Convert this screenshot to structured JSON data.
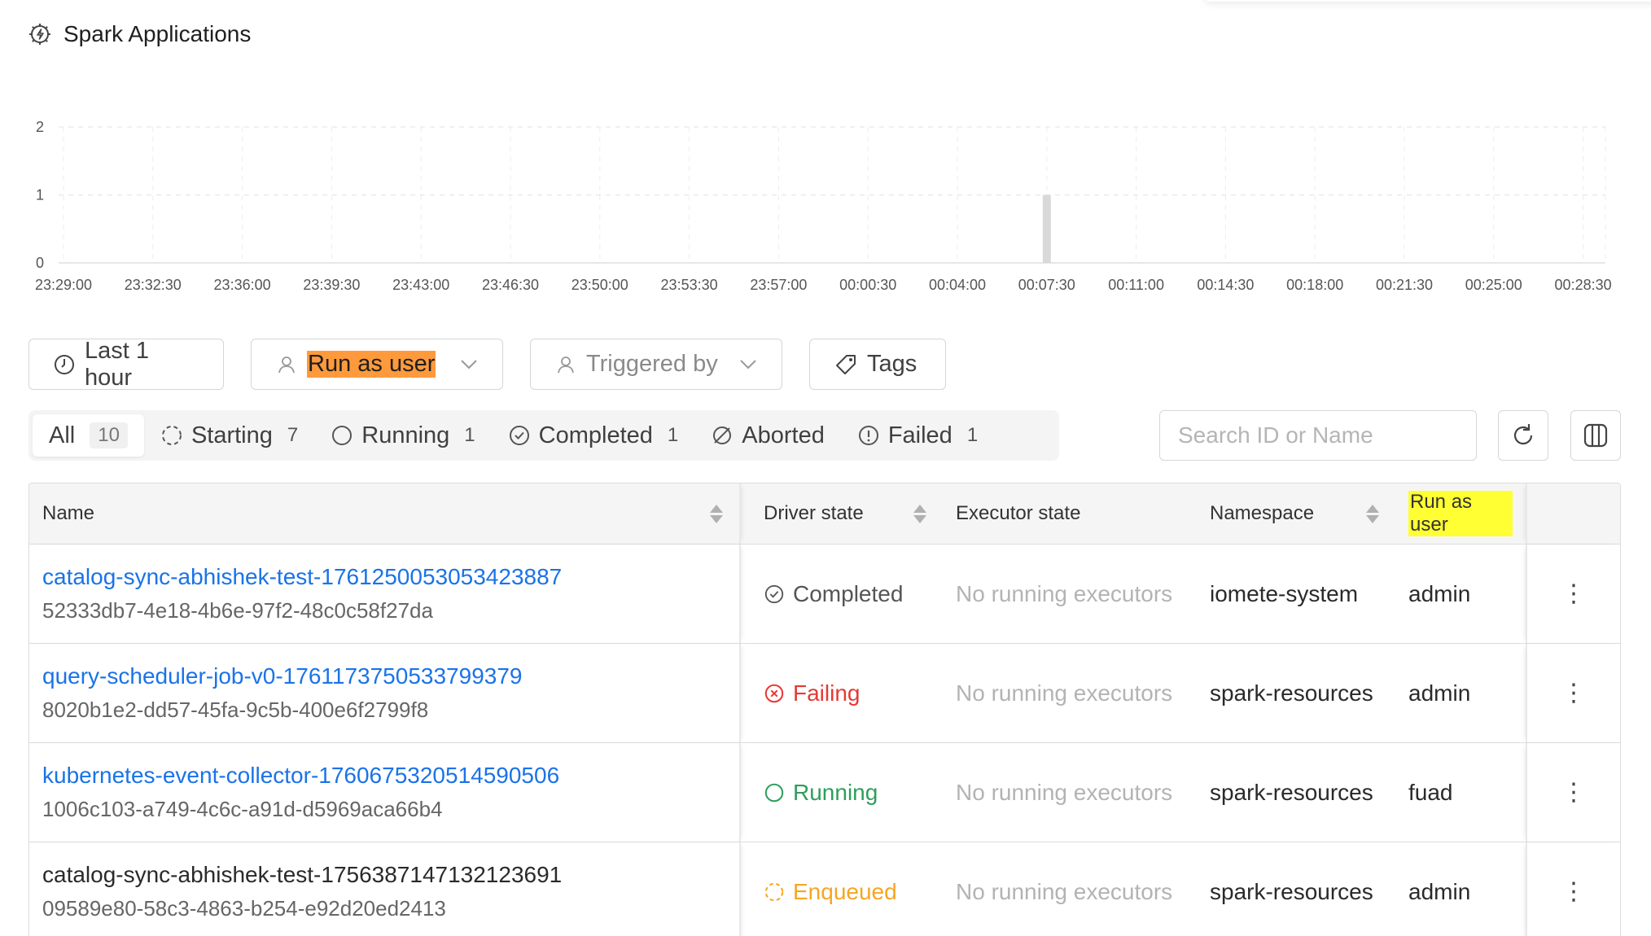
{
  "page": {
    "title": "Spark Applications",
    "title_icon": "spark-chip-icon"
  },
  "chart_data": {
    "type": "bar",
    "title": "",
    "xlabel": "",
    "ylabel": "",
    "ylim": [
      0,
      2
    ],
    "y_ticks": [
      "0",
      "1",
      "2"
    ],
    "x_ticks": [
      "23:29:00",
      "23:32:30",
      "23:36:00",
      "23:39:30",
      "23:43:00",
      "23:46:30",
      "23:50:00",
      "23:53:30",
      "23:57:00",
      "00:00:30",
      "00:04:00",
      "00:07:30",
      "00:11:00",
      "00:14:30",
      "00:18:00",
      "00:21:30",
      "00:25:00",
      "00:28:30"
    ],
    "bars": [
      {
        "x": "00:07:30",
        "value": 1
      }
    ],
    "grid": true,
    "bar_color": "#d9d9d9"
  },
  "filters": {
    "time": {
      "label": "Last 1 hour",
      "icon": "clock-icon"
    },
    "run_as_user": {
      "label": "Run as user",
      "icon": "user-icon"
    },
    "triggered_by": {
      "label": "Triggered by",
      "icon": "user-icon"
    },
    "tags": {
      "label": "Tags",
      "icon": "tag-icon"
    }
  },
  "status_tabs": [
    {
      "label": "All",
      "count": "10"
    },
    {
      "label": "Starting",
      "count": "7"
    },
    {
      "label": "Running",
      "count": "1"
    },
    {
      "label": "Completed",
      "count": "1"
    },
    {
      "label": "Aborted",
      "count": ""
    },
    {
      "label": "Failed",
      "count": "1"
    }
  ],
  "search": {
    "placeholder": "Search ID or Name"
  },
  "table": {
    "headers": {
      "name": "Name",
      "driver_state": "Driver state",
      "executor_state": "Executor state",
      "namespace": "Namespace",
      "run_as_user": "Run as user"
    },
    "rows": [
      {
        "name": "catalog-sync-abhishek-test-1761250053053423887",
        "id": "52333db7-4e18-4b6e-97f2-48c0c58f27da",
        "driver_state": "Completed",
        "executor_state": "No running executors",
        "namespace": "iomete-system",
        "user": "admin"
      },
      {
        "name": "query-scheduler-job-v0-1761173750533799379",
        "id": "8020b1e2-dd57-45fa-9c5b-400e6f2799f8",
        "driver_state": "Failing",
        "executor_state": "No running executors",
        "namespace": "spark-resources",
        "user": "admin"
      },
      {
        "name": "kubernetes-event-collector-1760675320514590506",
        "id": "1006c103-a749-4c6c-a91d-d5969aca66b4",
        "driver_state": "Running",
        "executor_state": "No running executors",
        "namespace": "spark-resources",
        "user": "fuad"
      },
      {
        "name": "catalog-sync-abhishek-test-1756387147132123691",
        "id": "09589e80-58c3-4863-b254-e92d20ed2413",
        "driver_state": "Enqueued",
        "executor_state": "No running executors",
        "namespace": "spark-resources",
        "user": "admin"
      }
    ]
  },
  "colors": {
    "link": "#1a73e8",
    "completed": "#555555",
    "failing": "#e53935",
    "running": "#2e9e5b",
    "enqueued": "#f5a623",
    "highlight_orange": "#ff9a3c",
    "highlight_yellow": "#ffff33"
  }
}
